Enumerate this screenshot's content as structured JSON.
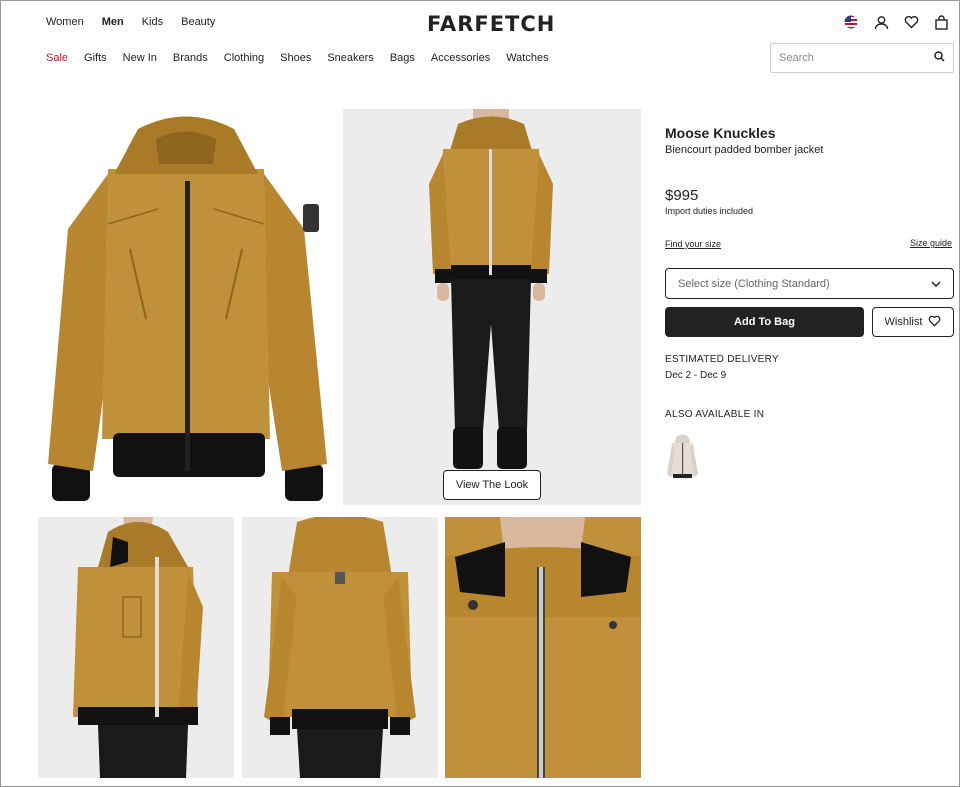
{
  "header": {
    "gender_tabs": [
      "Women",
      "Men",
      "Kids",
      "Beauty"
    ],
    "active_gender": "Men",
    "logo": "FARFETCH",
    "icons": [
      "us-flag-icon",
      "account-icon",
      "heart-icon",
      "bag-icon"
    ]
  },
  "nav": {
    "categories": [
      "Sale",
      "Gifts",
      "New In",
      "Brands",
      "Clothing",
      "Shoes",
      "Sneakers",
      "Bags",
      "Accessories",
      "Watches"
    ],
    "highlight_color": "#c4162a"
  },
  "search": {
    "placeholder": "Search"
  },
  "gallery": {
    "view_look_label": "View The Look",
    "jacket_color": "#b8862e"
  },
  "product": {
    "brand": "Moose Knuckles",
    "description": "Biencourt padded bomber jacket",
    "price": "$995",
    "duties": "Import duties included",
    "find_size": "Find your size",
    "size_guide": "Size guide",
    "size_placeholder": "Select size (Clothing Standard)",
    "add_to_bag": "Add To Bag",
    "wishlist": "Wishlist",
    "delivery_label": "ESTIMATED DELIVERY",
    "delivery_dates": "Dec 2 - Dec 9",
    "also_available": "ALSO AVAILABLE IN"
  }
}
